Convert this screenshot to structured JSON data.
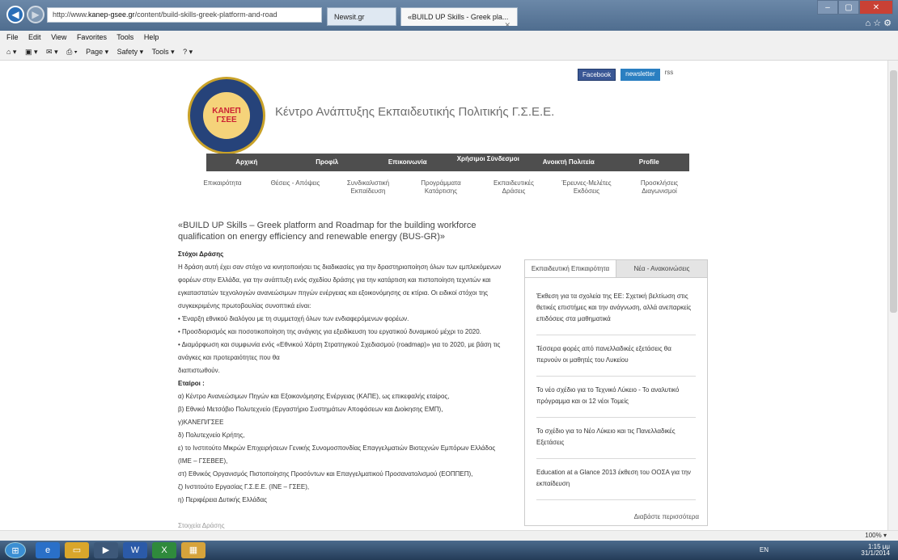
{
  "browser": {
    "url_prefix": "http://www.",
    "url_domain": "kanep-gsee.gr",
    "url_path": "/content/build-skills-greek-platform-and-road",
    "tab1": "Newsit.gr",
    "tab2": "«BUILD UP Skills - Greek pla...",
    "menu": [
      "File",
      "Edit",
      "View",
      "Favorites",
      "Tools",
      "Help"
    ],
    "commands": [
      "Page ▾",
      "Safety ▾",
      "Tools ▾"
    ]
  },
  "site": {
    "logo_text": "ΚΑΝΕΠ ΓΣΕΕ",
    "title": "Κέντρο Ανάπτυξης Εκπαιδευτικής Πολιτικής Γ.Σ.Ε.Ε.",
    "facebook": "Facebook",
    "newsletter": "newsletter",
    "rss": "rss"
  },
  "nav": {
    "top": [
      "Αρχική",
      "Προφίλ",
      "Επικοινωνία",
      "Χρήσιμοι Σύνδεσμοι",
      "Ανοικτή Πολιτεία",
      "Profile"
    ],
    "sub": [
      "Επικαιρότητα",
      "Θέσεις - Απόψεις",
      "Συνδικαλιστική\nΕκπαίδευση",
      "Προγράμματα\nΚατάρτισης",
      "Εκπαιδευτικές\nΔράσεις",
      "Έρευνες-Μελέτες\nΕκδόσεις",
      "Προσκλήσεις\nΔιαγωνισμοί"
    ]
  },
  "article": {
    "heading": "«BUILD UP Skills – Greek platform and Roadmap for the building workforce qualification on energy efficiency and renewable energy (BUS-GR)»",
    "goal_label": "Στόχοι Δράσης",
    "para1": "Η δράση αυτή έχει σαν στόχο να κινητοποιήσει τις διαδικασίες για την δραστηριοποίηση όλων των εμπλεκόμενων φορέων στην Ελλάδα, για την ανάπτυξη ενός σχεδίου δράσης για την κατάρτιση και πιστοποίηση τεχνιτών και εγκαταστατών τεχνολογιών ανανεώσιμων πηγών ενέργειας και εξοικονόμησης σε κτίρια. Οι ειδικοί στόχοι της συγκεκριμένης πρωτοβουλίας συνοπτικά είναι:",
    "bullet1": "• Έναρξη εθνικού διαλόγου με τη συμμετοχή όλων των ενδιαφερόμενων φορέων.",
    "bullet2": "• Προσδιορισμός και ποσοτικοποίηση της ανάγκης για εξειδίκευση του εργατικού δυναμικού μέχρι το 2020.",
    "bullet3": "• Διαμόρφωση και συμφωνία ενός «Εθνικού Χάρτη Στρατηγικού Σχεδιασμού (roadmap)» για το 2020, με βάση τις ανάγκες και προτεραιότητες που θα",
    "bullet3b": "διαπιστωθούν.",
    "partners_label": "Εταίροι :",
    "p1": "α) Κέντρο Ανανεώσιμων Πηγών και Εξοικονόμησης Ενέργειας (ΚΑΠΕ), ως επικεφαλής εταίρος,",
    "p2": "β) Εθνικό Μετσόβιο Πολυτεχνείο (Εργαστήριο Συστημάτων Αποφάσεων και Διοίκησης ΕΜΠ),",
    "p2b": "γ)ΚΑΝΕΠ/ΓΣΕΕ",
    "p3": "δ) Πολυτεχνείο Κρήτης,",
    "p4": "ε) το Ινστιτούτο Μικρών Επιχειρήσεων Γενικής Συνομοσπονδίας Επαγγελματιών Βιοτεχνών Εμπόρων Ελλάδος",
    "p4b": "(ΙΜΕ – ΓΣΕΒΕΕ),",
    "p5": "στ) Εθνικός Οργανισμός Πιστοποίησης Προσόντων και Επαγγελματικού Προσανατολισμού (ΕΟΠΠΕΠ),",
    "p6": "ζ) Ινστιτούτο Εργασίας Γ.Σ.Ε.Ε. (ΙΝΕ – ΓΣΕΕ),",
    "p7": "η) Περιφέρεια Δυτικής Ελλάδας",
    "cut": "Στοιχεία Δράσης"
  },
  "sidebar": {
    "tab_active": "Εκπαιδευτική Επικαιρότητα",
    "tab_other": "Νέα - Ανακοινώσεις",
    "items": [
      "Έκθεση για τα σχολεία της ΕΕ: Σχετική βελτίωση στις θετικές επιστήμες και την ανάγνωση, αλλά ανεπαρκείς επιδόσεις στα μαθηματικά",
      "Τέσσερα φορές από πανελλαδικές εξετάσεις θα περνούν οι μαθητές του Λυκείου",
      "Το νέο σχέδιο για το Τεχνικό Λύκειο - Το αναλυτικό πρόγραμμα και οι 12 νέοι Τομείς",
      "Το σχέδιο για το Νέο Λύκειο και τις Πανελλαδικές Εξετάσεις",
      "Education at a Glance 2013 έκθεση του ΟΟΣΑ για την εκπαίδευση"
    ],
    "more": "Διαβάστε περισσότερα"
  },
  "status": {
    "zoom": "100%"
  },
  "taskbar": {
    "lang": "EN",
    "time": "1:15 μμ",
    "date": "31/1/2014"
  }
}
